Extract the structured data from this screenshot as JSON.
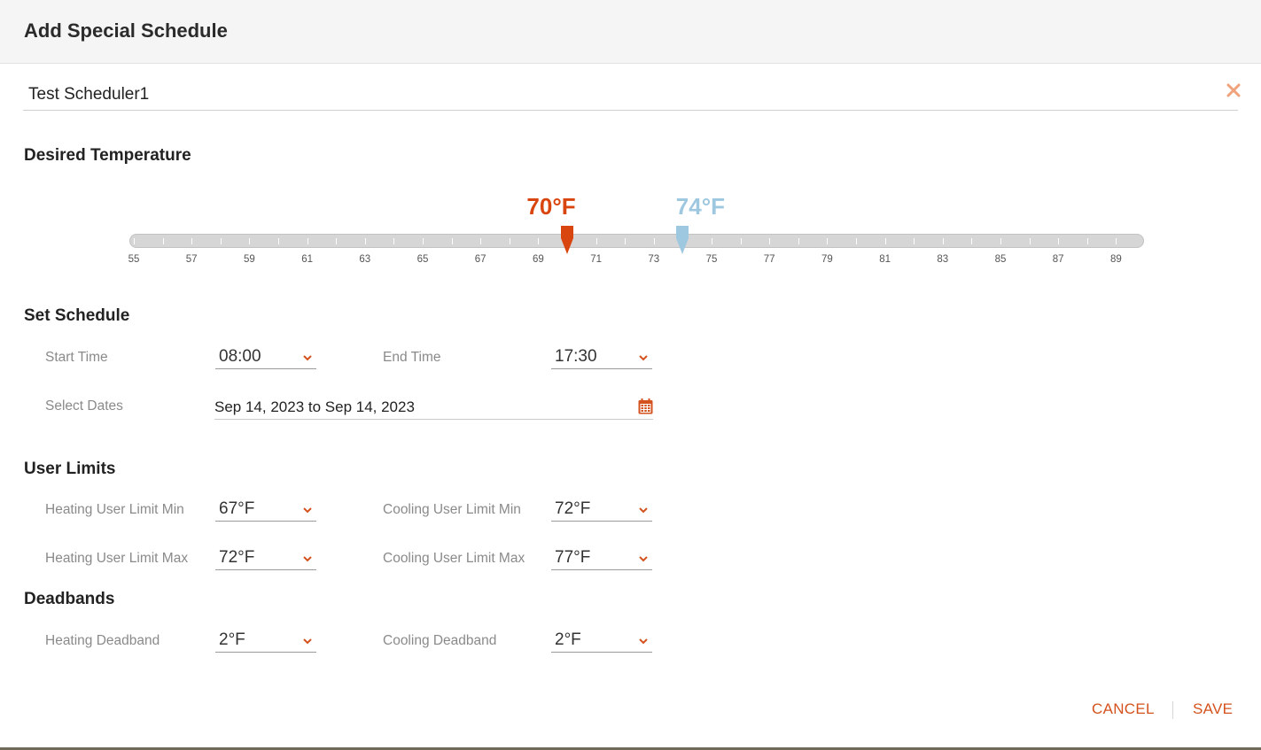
{
  "dialog": {
    "title": "Add Special Schedule"
  },
  "schedule_name": {
    "value": "Test Scheduler1"
  },
  "sections": {
    "desired_temperature": "Desired Temperature",
    "set_schedule": "Set Schedule",
    "user_limits": "User Limits",
    "deadbands": "Deadbands"
  },
  "temperature_slider": {
    "min": 55,
    "max": 90,
    "tick_labels": [
      "55",
      "57",
      "59",
      "61",
      "63",
      "65",
      "67",
      "69",
      "71",
      "73",
      "75",
      "77",
      "79",
      "81",
      "83",
      "85",
      "87",
      "89"
    ],
    "heating_value": 70,
    "heating_label": "70°F",
    "cooling_value": 74,
    "cooling_label": "74°F",
    "heating_color": "#d9450f",
    "cooling_color": "#9ec7e0"
  },
  "schedule": {
    "start_time_label": "Start Time",
    "start_time": "08:00",
    "end_time_label": "End Time",
    "end_time": "17:30",
    "select_dates_label": "Select Dates",
    "dates": "Sep 14, 2023 to Sep 14, 2023"
  },
  "user_limits": {
    "heating_min_label": "Heating User Limit Min",
    "heating_min": "67°F",
    "cooling_min_label": "Cooling User Limit Min",
    "cooling_min": "72°F",
    "heating_max_label": "Heating User Limit Max",
    "heating_max": "72°F",
    "cooling_max_label": "Cooling User Limit Max",
    "cooling_max": "77°F"
  },
  "deadbands": {
    "heating_label": "Heating Deadband",
    "heating": "2°F",
    "cooling_label": "Cooling Deadband",
    "cooling": "2°F"
  },
  "footer": {
    "cancel_label": "CANCEL",
    "save_label": "SAVE"
  },
  "icons": {
    "close": "close-icon",
    "chevron": "chevron-down-icon",
    "calendar": "calendar-icon"
  },
  "colors": {
    "accent": "#d4521d"
  }
}
